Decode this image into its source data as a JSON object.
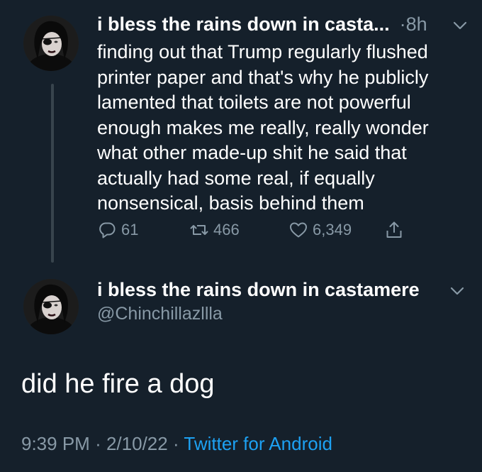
{
  "tweet1": {
    "display_name": "i bless the rains down in casta...",
    "time_separator": "·",
    "time": "8h",
    "body": "finding out that Trump regularly flushed printer paper and that's why he publicly lamented that toilets are not powerful enough makes me really, really wonder what other made-up shit he said that actually had some real, if equally nonsensical, basis behind them",
    "body_lines": [
      "finding out that Trump regularly flushed",
      "printer paper and that's why he publicly",
      "lamented that toilets are not powerful",
      "enough makes me really, really wonder",
      "what other made-up shit he said that",
      "actually had some real, if equally",
      "nonsensical, basis behind them"
    ],
    "actions": {
      "replies": "61",
      "retweets": "466",
      "likes": "6,349"
    }
  },
  "tweet2": {
    "display_name": "i bless the rains down in castamere",
    "handle": "@Chinchillazllla",
    "body": "did he fire a dog",
    "time": "9:39 PM",
    "date": "2/10/22",
    "separator": "·",
    "source": "Twitter for Android"
  },
  "colors": {
    "background": "#15202b",
    "secondary_text": "#8899a6",
    "link": "#1da1f2",
    "thread_line": "#38444d"
  },
  "icons": {
    "reply": "reply-icon",
    "retweet": "retweet-icon",
    "like": "heart-icon",
    "share": "share-icon",
    "more": "chevron-down-icon"
  }
}
